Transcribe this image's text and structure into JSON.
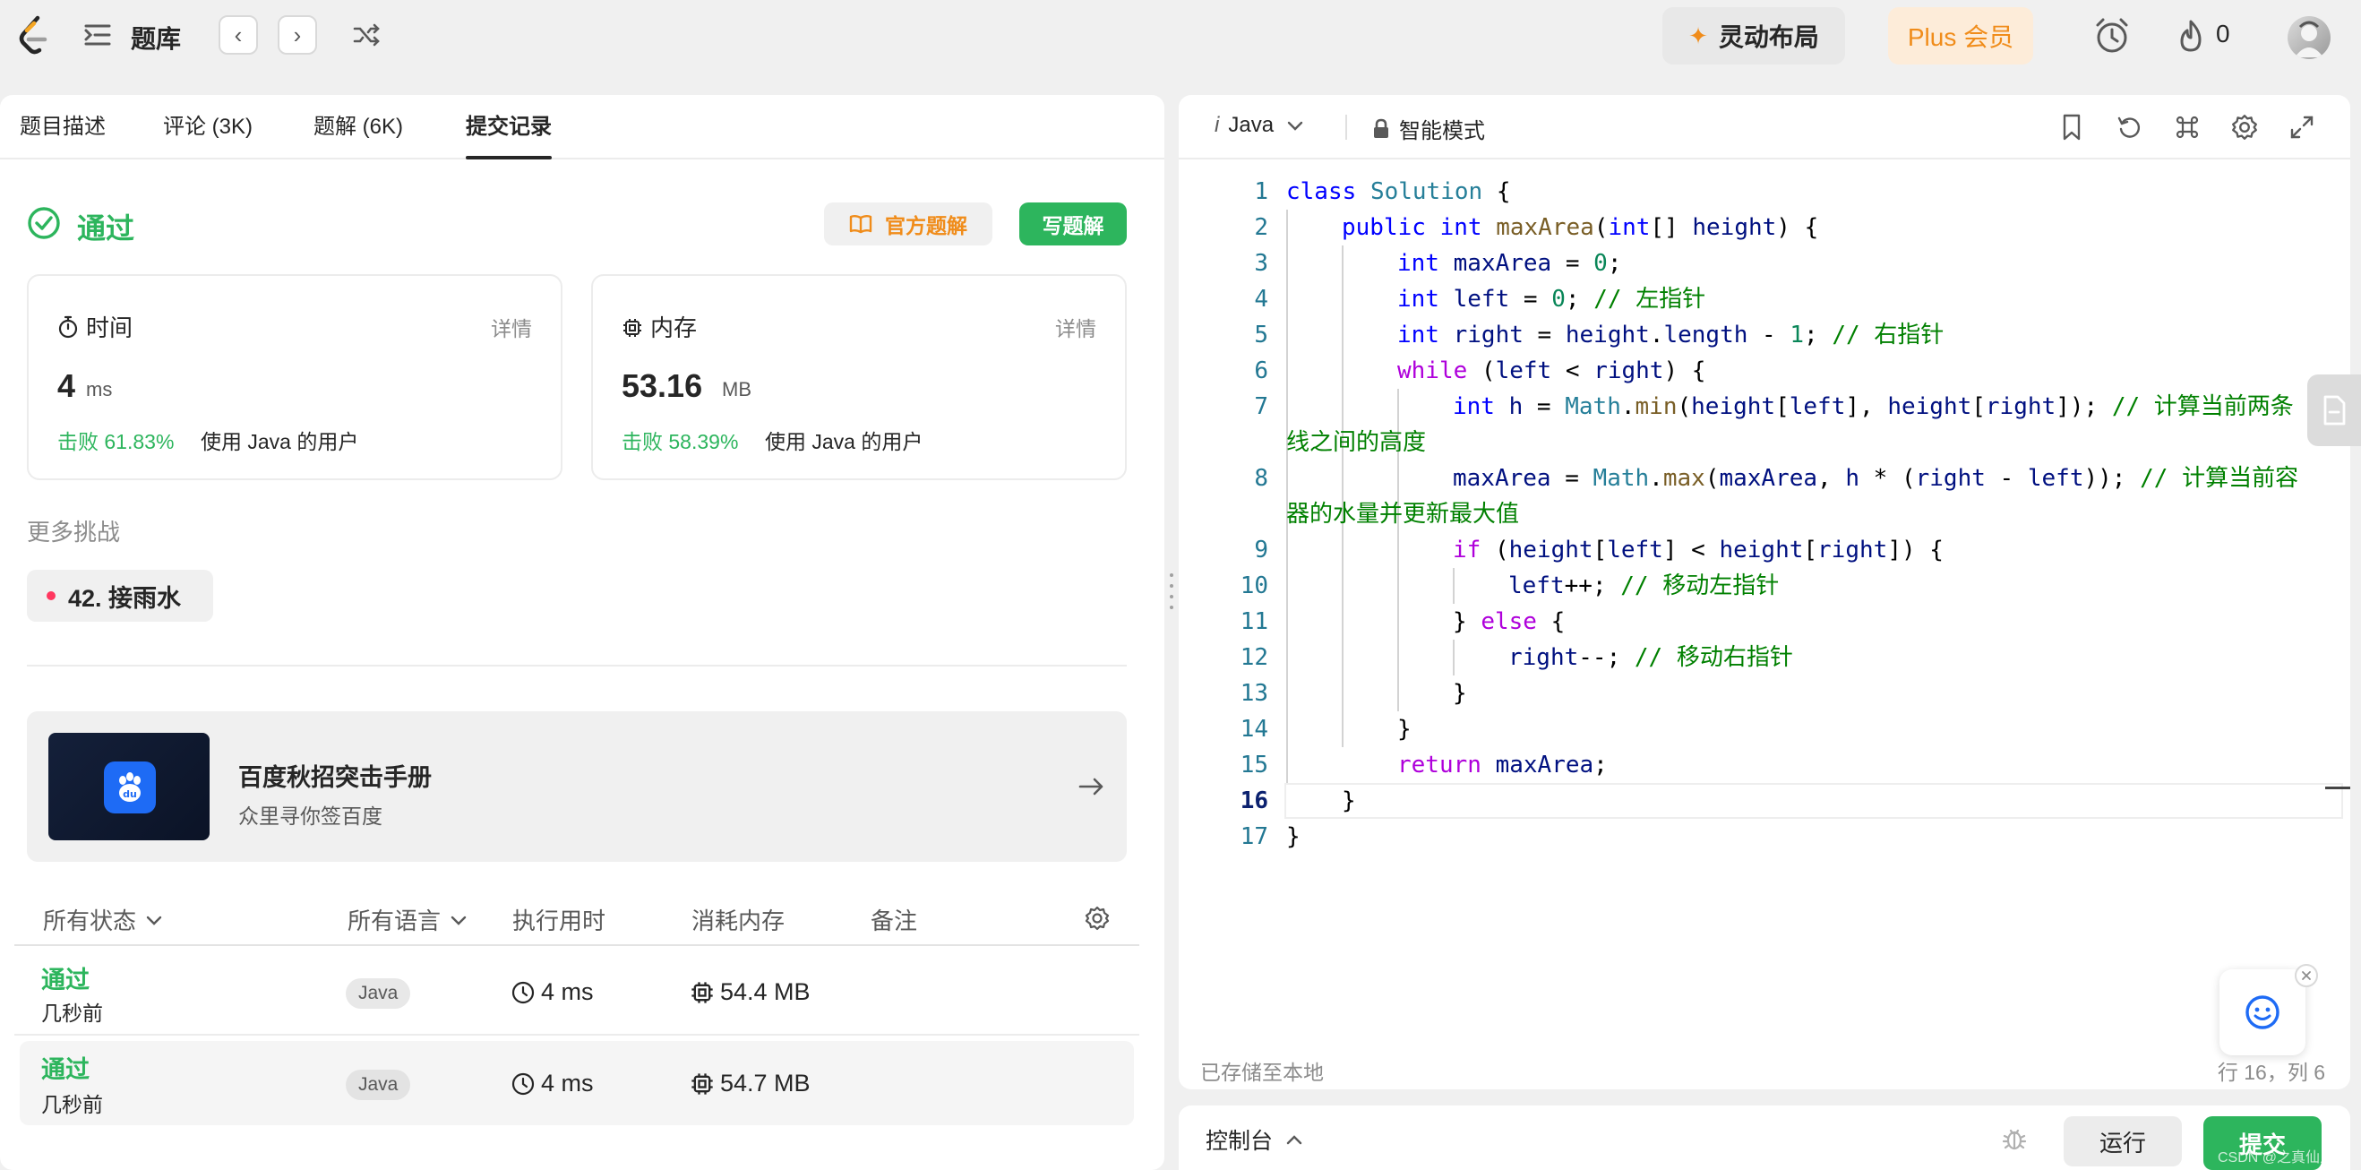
{
  "header": {
    "problem_bank_label": "题库",
    "flexible_layout_label": "灵动布局",
    "plus_member_label": "Plus 会员",
    "streak_count": "0"
  },
  "left_panel": {
    "tabs": [
      {
        "label": "题目描述"
      },
      {
        "label": "评论 (3K)"
      },
      {
        "label": "题解 (6K)"
      },
      {
        "label": "提交记录"
      }
    ],
    "active_tab": "提交记录",
    "result_status": "通过",
    "official_solution_label": "官方题解",
    "write_solution_label": "写题解",
    "time_card": {
      "title": "时间",
      "detail_label": "详情",
      "value": "4",
      "unit": "ms",
      "beat_text": "击败 61.83%",
      "beat_suffix": "使用 Java 的用户"
    },
    "memory_card": {
      "title": "内存",
      "detail_label": "详情",
      "value": "53.16",
      "unit": "MB",
      "beat_text": "击败 58.39%",
      "beat_suffix": "使用 Java 的用户"
    },
    "more_challenges_label": "更多挑战",
    "challenge_item": "42. 接雨水",
    "ad": {
      "title": "百度秋招突击手册",
      "subtitle": "众里寻你签百度",
      "logo_text": "du"
    },
    "table": {
      "headers": [
        "所有状态",
        "所有语言",
        "执行用时",
        "消耗内存",
        "备注"
      ],
      "rows": [
        {
          "status": "通过",
          "time_ago": "几秒前",
          "language": "Java",
          "runtime": "4 ms",
          "memory": "54.4 MB"
        },
        {
          "status": "通过",
          "time_ago": "几秒前",
          "language": "Java",
          "runtime": "4 ms",
          "memory": "54.7 MB"
        }
      ]
    }
  },
  "editor": {
    "language_prefix": "i",
    "language": "Java",
    "smart_mode_label": "智能模式",
    "line_numbers": [
      "1",
      "2",
      "3",
      "4",
      "5",
      "6",
      "7",
      "8",
      "9",
      "10",
      "11",
      "12",
      "13",
      "14",
      "15",
      "16",
      "17"
    ],
    "lines": {
      "l1": {
        "a": "class",
        "b": " ",
        "c": "Solution",
        "d": " {"
      },
      "l2": {
        "a": "public",
        "b": " ",
        "c": "int",
        "d": " ",
        "e": "maxArea",
        "f": "(",
        "g": "int",
        "h": "[] ",
        "i": "height",
        "j": ") {"
      },
      "l3": {
        "a": "int",
        "b": " ",
        "c": "maxArea",
        "d": " = ",
        "e": "0",
        "f": ";"
      },
      "l4": {
        "a": "int",
        "b": " ",
        "c": "left",
        "d": " = ",
        "e": "0",
        "f": "; ",
        "g": "// 左指针"
      },
      "l5": {
        "a": "int",
        "b": " ",
        "c": "right",
        "d": " = ",
        "e": "height",
        "f": ".",
        "g": "length",
        "h": " - ",
        "i": "1",
        "j": "; ",
        "k": "// 右指针"
      },
      "l6": {
        "a": "while",
        "b": " (",
        "c": "left",
        "d": " < ",
        "e": "right",
        "f": ") {"
      },
      "l7": {
        "a": "int",
        "b": " ",
        "c": "h",
        "d": " = ",
        "e": "Math",
        "f": ".",
        "g": "min",
        "h": "(",
        "i": "height",
        "j": "[",
        "k": "left",
        "l": "], ",
        "m": "height",
        "n": "[",
        "o": "right",
        "p": "]); ",
        "q": "// 计算当前两条",
        "r": "线之间的高度"
      },
      "l8": {
        "a": "maxArea",
        "b": " = ",
        "c": "Math",
        "d": ".",
        "e": "max",
        "f": "(",
        "g": "maxArea",
        "h": ", ",
        "i": "h",
        "j": " * (",
        "k": "right",
        "l": " - ",
        "m": "left",
        "n": ")); ",
        "o": "// 计算当前容",
        "p": "器的水量并更新最大值"
      },
      "l9": {
        "a": "if",
        "b": " (",
        "c": "height",
        "d": "[",
        "e": "left",
        "f": "] < ",
        "g": "height",
        "h": "[",
        "i": "right",
        "j": "]) {"
      },
      "l10": {
        "a": "left",
        "b": "++; ",
        "c": "// 移动左指针"
      },
      "l11": {
        "a": "} ",
        "b": "else",
        "c": " {"
      },
      "l12": {
        "a": "right",
        "b": "--; ",
        "c": "// 移动右指针"
      },
      "l13": {
        "a": "}"
      },
      "l14": {
        "a": "}"
      },
      "l15": {
        "a": "return",
        "b": " ",
        "c": "maxArea",
        "d": ";"
      },
      "l16": {
        "a": "}"
      },
      "l17": {
        "a": "}"
      }
    },
    "saved_status": "已存储至本地",
    "cursor_position": "行 16，列 6"
  },
  "console": {
    "label": "控制台",
    "run_label": "运行",
    "submit_label": "提交",
    "watermark": "CSDN @之真仙人"
  },
  "colors": {
    "accept_green": "#2db55d",
    "submit_green": "#2db55d",
    "plus_orange": "#f08c1a",
    "official_orange": "#f08c1a"
  }
}
